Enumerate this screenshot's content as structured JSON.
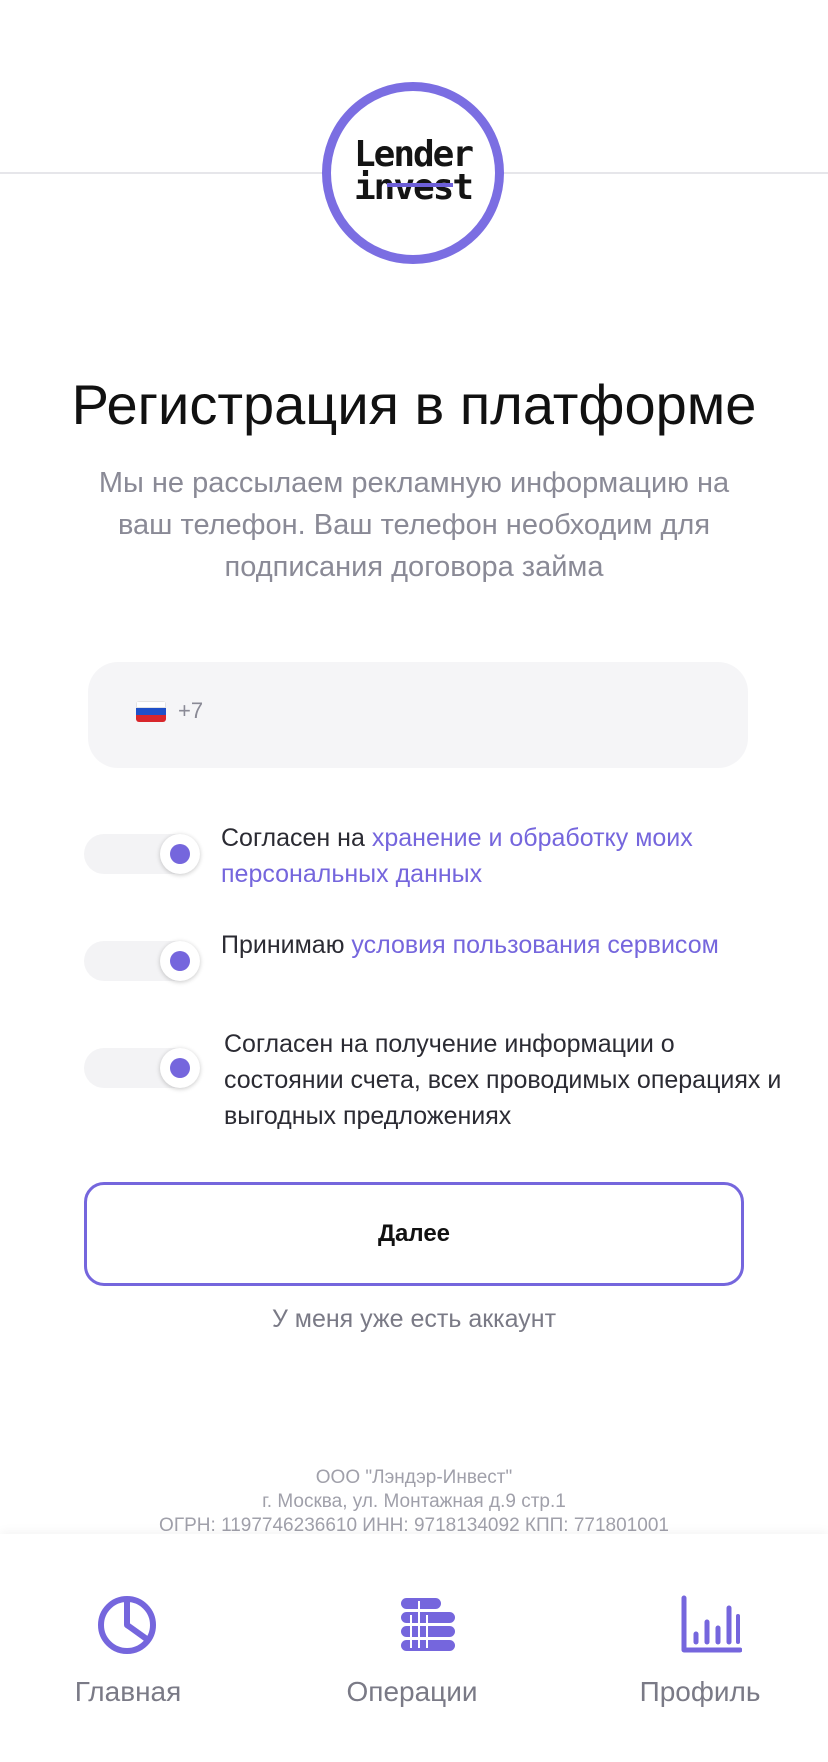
{
  "brand": {
    "logo_line1": "Lender",
    "logo_line2": "invest",
    "accent_color": "#7566dd"
  },
  "registration": {
    "title": "Регистрация в платформе",
    "subtitle": "Мы не рассылаем рекламную информацию на ваш телефон. Ваш телефон необходим для подписания договора займа"
  },
  "phone": {
    "country_flag": "russia-flag",
    "code": "+7",
    "value": ""
  },
  "consents": [
    {
      "prefix": "Согласен на ",
      "link": "хранение и обработку моих персональных данных",
      "state": "on"
    },
    {
      "prefix": "Принимаю ",
      "link": "условия пользования сервисом",
      "state": "on"
    },
    {
      "text": "Согласен на получение информации о состоянии счета, всех проводимых операциях и выгодных предложениях",
      "state": "on"
    }
  ],
  "actions": {
    "next_label": "Далее",
    "have_account_label": "У меня уже есть аккаунт"
  },
  "footer": {
    "company": "ООО \"Лэндэр-Инвест\"",
    "address": "г. Москва, ул. Монтажная д.9 стр.1",
    "requisites": "ОГРН: 1197746236610 ИНН: 9718134092 КПП: 771801001"
  },
  "bottom_nav": [
    {
      "label": "Главная",
      "icon": "pie-chart-icon"
    },
    {
      "label": "Операции",
      "icon": "coin-stack-icon"
    },
    {
      "label": "Профиль",
      "icon": "bar-chart-icon"
    }
  ]
}
